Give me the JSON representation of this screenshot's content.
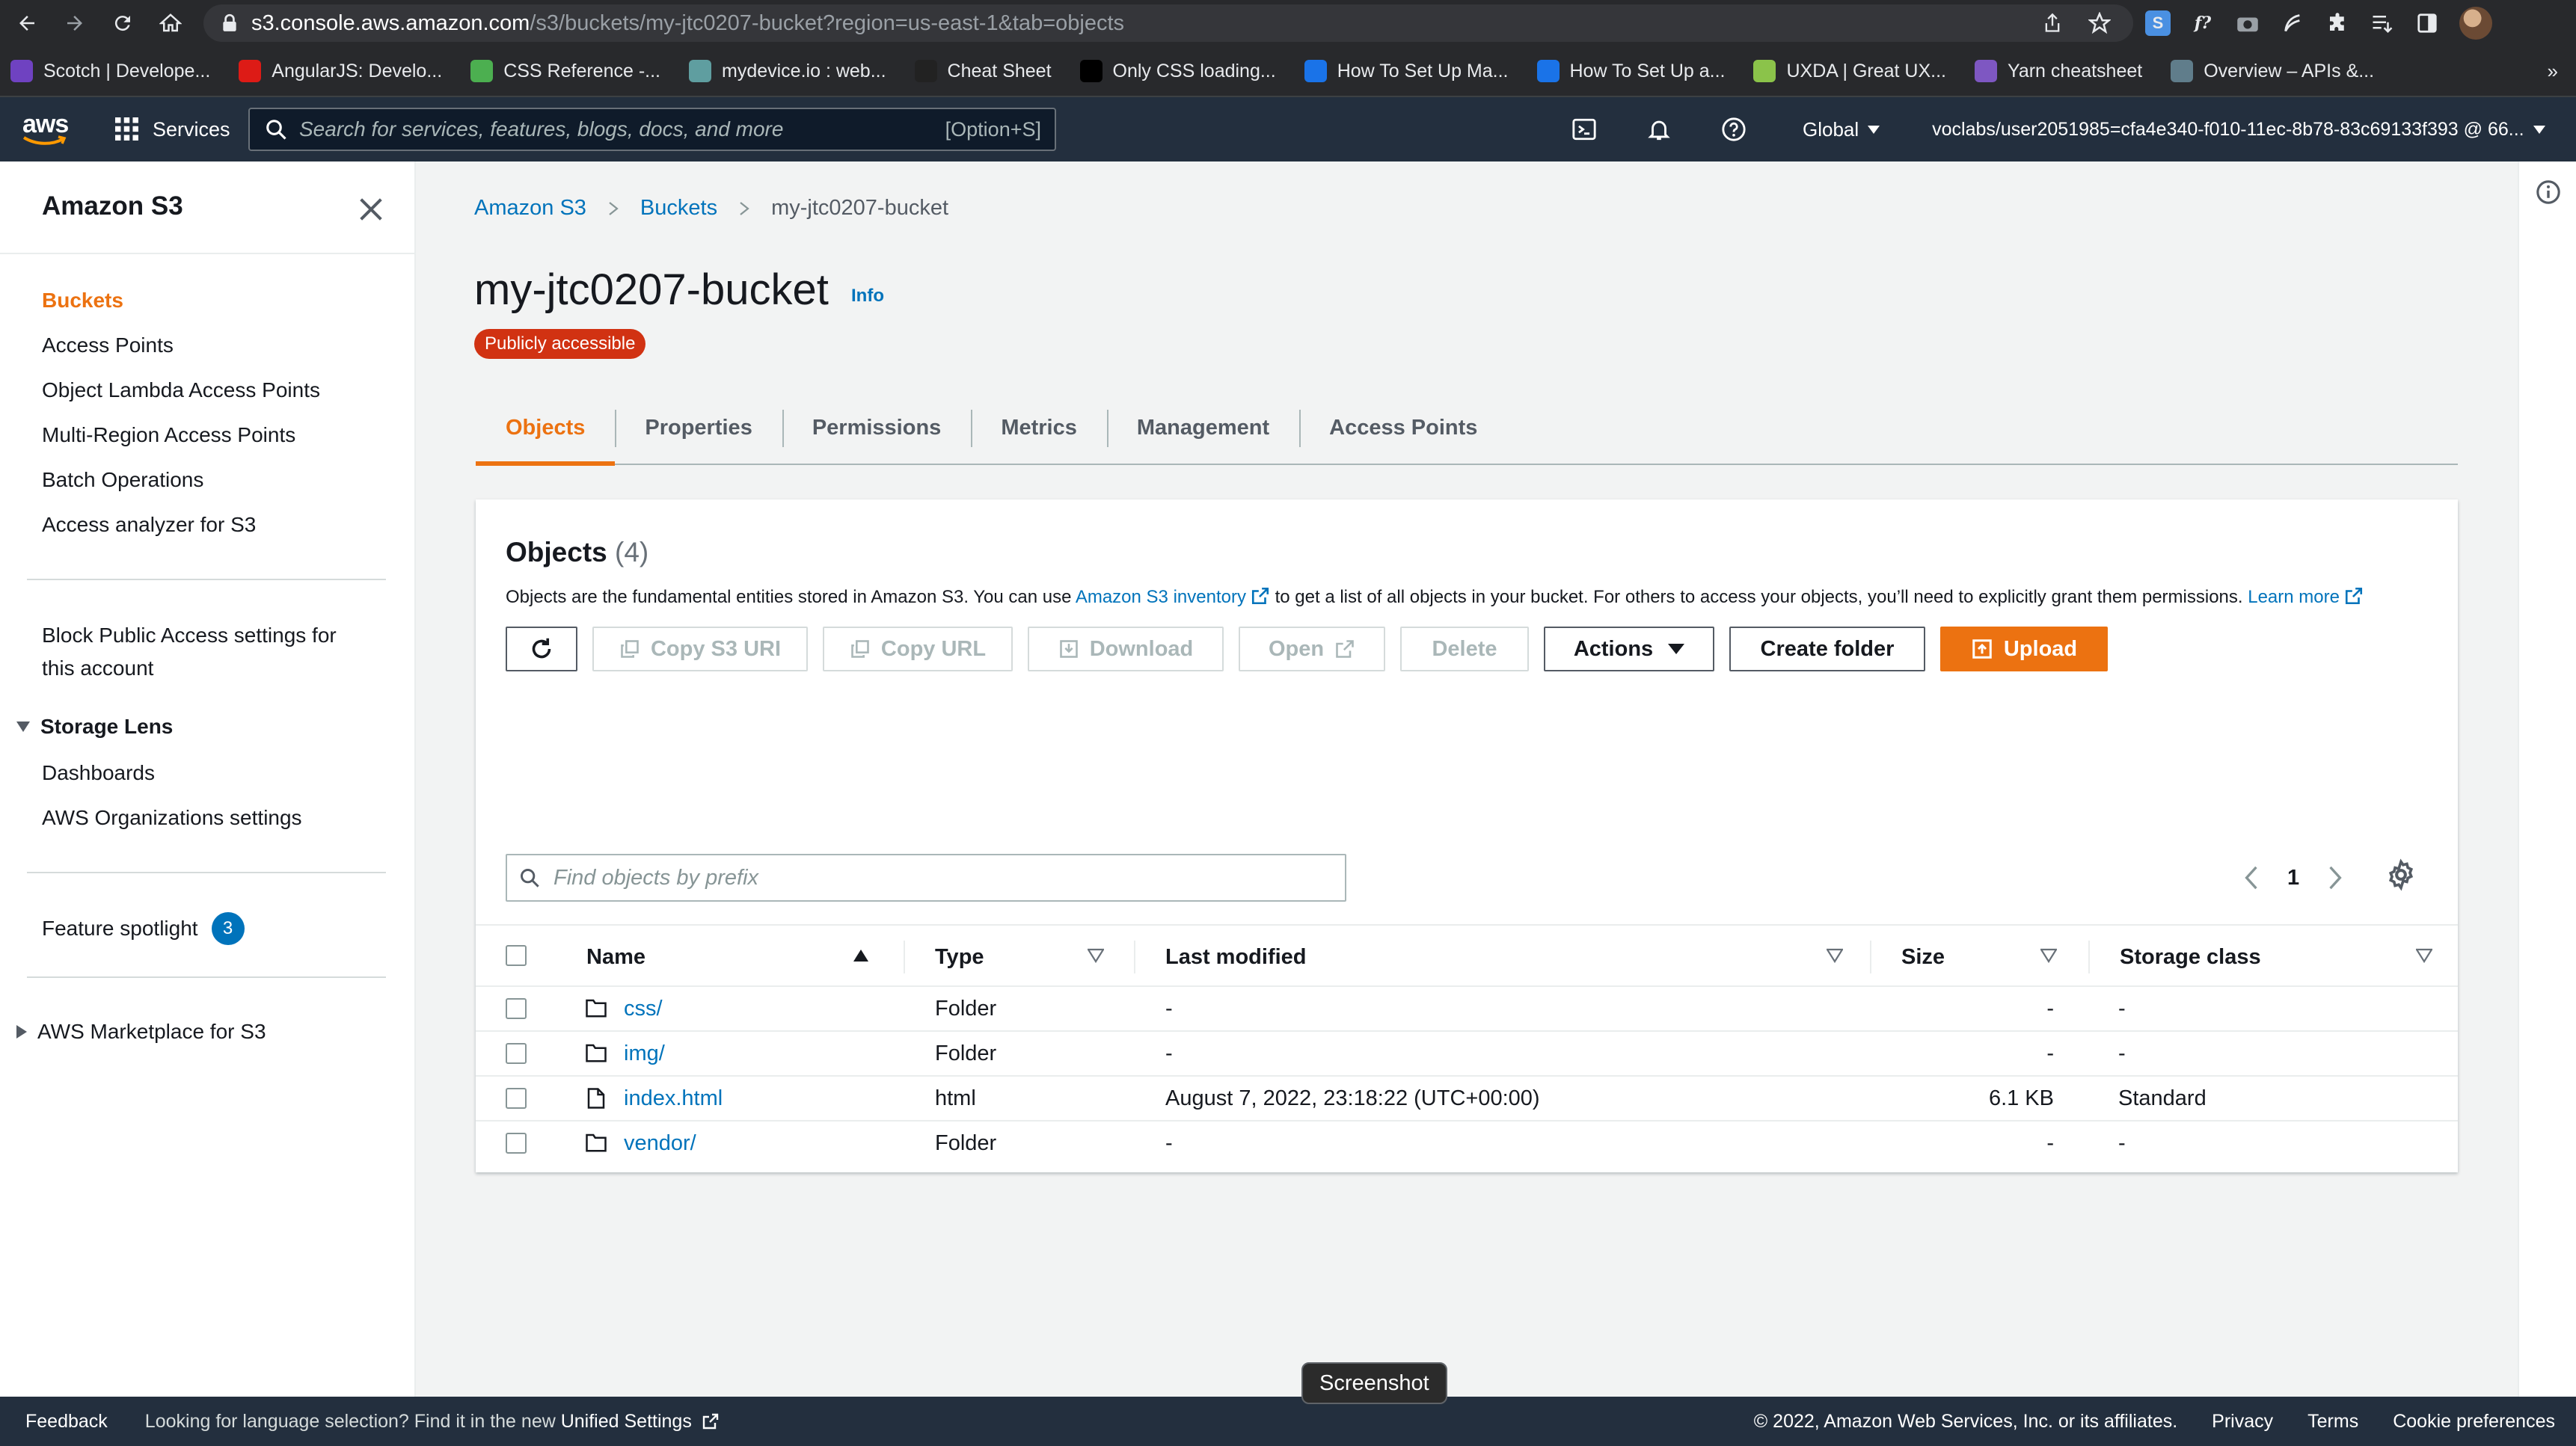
{
  "browser": {
    "url_host": "s3.console.aws.amazon.com",
    "url_path": "/s3/buckets/my-jtc0207-bucket?region=us-east-1&tab=objects"
  },
  "bookmarks": [
    {
      "label": "Scotch | Develope...",
      "color": "#6f42c1"
    },
    {
      "label": "AngularJS: Develo...",
      "color": "#dd1b16"
    },
    {
      "label": "CSS Reference -...",
      "color": "#4caf50"
    },
    {
      "label": "mydevice.io : web...",
      "color": "#5f9ea0"
    },
    {
      "label": "Cheat Sheet",
      "color": "#222222"
    },
    {
      "label": "Only CSS loading...",
      "color": "#000000"
    },
    {
      "label": "How To Set Up Ma...",
      "color": "#1a73e8"
    },
    {
      "label": "How To Set Up a...",
      "color": "#1a73e8"
    },
    {
      "label": "UXDA | Great UX...",
      "color": "#8bc34a"
    },
    {
      "label": "Yarn cheatsheet",
      "color": "#7e57c2"
    },
    {
      "label": "Overview – APIs &...",
      "color": "#607d8b"
    }
  ],
  "bookmarks_more": "»",
  "aws_nav": {
    "logo": "aws",
    "services": "Services",
    "search_placeholder": "Search for services, features, blogs, docs, and more",
    "search_shortcut": "[Option+S]",
    "region": "Global",
    "account": "voclabs/user2051985=cfa4e340-f010-11ec-8b78-83c69133f393 @ 66..."
  },
  "sidebar": {
    "title": "Amazon S3",
    "items": [
      {
        "label": "Buckets",
        "active": true
      },
      {
        "label": "Access Points"
      },
      {
        "label": "Object Lambda Access Points"
      },
      {
        "label": "Multi-Region Access Points"
      },
      {
        "label": "Batch Operations"
      },
      {
        "label": "Access analyzer for S3"
      }
    ],
    "block_public_line1": "Block Public Access settings for",
    "block_public_line2": "this account",
    "storage_lens": {
      "label": "Storage Lens",
      "items": [
        {
          "label": "Dashboards"
        },
        {
          "label": "AWS Organizations settings"
        }
      ]
    },
    "feature_spotlight": {
      "label": "Feature spotlight",
      "count": "3"
    },
    "marketplace": "AWS Marketplace for S3"
  },
  "breadcrumb": {
    "items": [
      "Amazon S3",
      "Buckets"
    ],
    "current": "my-jtc0207-bucket"
  },
  "bucket": {
    "name": "my-jtc0207-bucket",
    "info": "Info",
    "status": "Publicly accessible",
    "status_color": "#d13212"
  },
  "tabs": [
    "Objects",
    "Properties",
    "Permissions",
    "Metrics",
    "Management",
    "Access Points"
  ],
  "active_tab": "Objects",
  "objects": {
    "title": "Objects",
    "count": "(4)",
    "desc_pre": "Objects are the fundamental entities stored in Amazon S3. You can use ",
    "desc_link": "Amazon S3 inventory",
    "desc_post": " to get a list of all objects in your bucket. For others to access your objects, you’ll need to explicitly grant them permissions.",
    "learn_more": "Learn more",
    "buttons": {
      "copy_uri": "Copy S3 URI",
      "copy_url": "Copy URL",
      "download": "Download",
      "open": "Open",
      "delete": "Delete",
      "actions": "Actions",
      "create_folder": "Create folder",
      "upload": "Upload"
    },
    "filter_placeholder": "Find objects by prefix",
    "page": "1",
    "columns": [
      "Name",
      "Type",
      "Last modified",
      "Size",
      "Storage class"
    ],
    "rows": [
      {
        "name": "css/",
        "kind": "folder",
        "type": "Folder",
        "modified": "-",
        "size": "-",
        "storage": "-"
      },
      {
        "name": "img/",
        "kind": "folder",
        "type": "Folder",
        "modified": "-",
        "size": "-",
        "storage": "-"
      },
      {
        "name": "index.html",
        "kind": "file",
        "type": "html",
        "modified": "August 7, 2022, 23:18:22 (UTC+00:00)",
        "size": "6.1 KB",
        "storage": "Standard"
      },
      {
        "name": "vendor/",
        "kind": "folder",
        "type": "Folder",
        "modified": "-",
        "size": "-",
        "storage": "-"
      }
    ]
  },
  "footer": {
    "feedback": "Feedback",
    "lang_pre": "Looking for language selection? Find it in the new ",
    "lang_link": "Unified Settings",
    "copyright": "© 2022, Amazon Web Services, Inc. or its affiliates.",
    "privacy": "Privacy",
    "terms": "Terms",
    "cookies": "Cookie preferences"
  },
  "tooltip": "Screenshot",
  "colors": {
    "accent": "#ec7211",
    "link": "#0073bb",
    "nav_bg": "#232f3e"
  }
}
